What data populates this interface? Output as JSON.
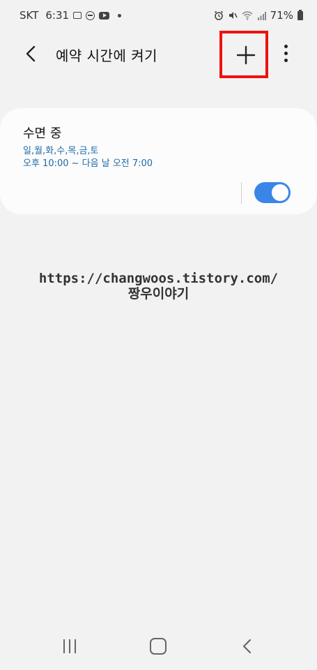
{
  "status_bar": {
    "carrier": "SKT",
    "time": "6:31",
    "battery": "71%",
    "left_icons": [
      "image-icon",
      "dnd-icon",
      "youtube-icon",
      "dot-icon"
    ],
    "right_icons": [
      "alarm-icon",
      "mute-icon",
      "wifi-icon",
      "signal-icon",
      "battery-icon"
    ]
  },
  "app_bar": {
    "title": "예약 시간에 켜기",
    "back_icon": "chevron-left-icon",
    "add_icon": "plus-icon",
    "more_icon": "more-vertical-icon",
    "highlight_color": "#ee1111"
  },
  "schedule": {
    "name": "수면 중",
    "days": "일,월,화,수,목,금,토",
    "time_range": "오후 10:00 ~ 다음 날 오전 7:00",
    "enabled": true,
    "accent_color": "#3a86e8",
    "detail_color": "#1e6aa8"
  },
  "watermark": {
    "url": "https://changwoos.tistory.com/",
    "name": "짱우이야기"
  },
  "nav_bar": {
    "icons": [
      "recent-apps-icon",
      "home-icon",
      "back-icon"
    ]
  }
}
